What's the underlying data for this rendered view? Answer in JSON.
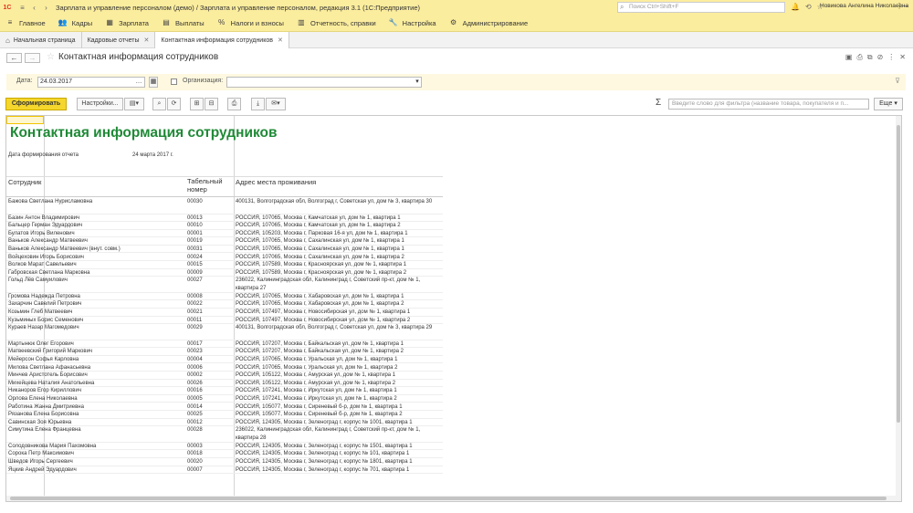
{
  "app": {
    "logo": "1С",
    "title": "Зарплата и управление персоналом (демо) / Зарплата и управление персоналом, редакция 3.1  (1С:Предприятие)",
    "search_placeholder": "Поиск Ctrl+Shift+F",
    "user": "Новикова Ангелина Николаевна"
  },
  "menu": [
    {
      "icon": "hamburger-icon",
      "glyph": "≡",
      "label": "Главное"
    },
    {
      "icon": "people-icon",
      "glyph": "👥",
      "label": "Кадры"
    },
    {
      "icon": "salary-icon",
      "glyph": "▦",
      "label": "Зарплата"
    },
    {
      "icon": "payments-icon",
      "glyph": "▤",
      "label": "Выплаты"
    },
    {
      "icon": "percent-icon",
      "glyph": "%",
      "label": "Налоги и взносы"
    },
    {
      "icon": "reports-icon",
      "glyph": "▥",
      "label": "Отчетность, справки"
    },
    {
      "icon": "wrench-icon",
      "glyph": "🔧",
      "label": "Настройка"
    },
    {
      "icon": "admin-icon",
      "glyph": "⚙",
      "label": "Администрирование"
    }
  ],
  "tabs": [
    {
      "label": "Начальная страница",
      "active": false
    },
    {
      "label": "Кадровые отчеты",
      "active": false
    },
    {
      "label": "Контактная информация сотрудников",
      "active": true
    }
  ],
  "form": {
    "title": "Контактная информация сотрудников"
  },
  "params": {
    "date_label": "Дата:",
    "date_value": "24.03.2017",
    "org_label": "Организация:",
    "org_value": ""
  },
  "toolbar": {
    "generate": "Сформировать",
    "settings": "Настройки...",
    "filter_placeholder": "Введите слово для фильтра (название товара, покупателя и п...",
    "more": "Еще"
  },
  "report": {
    "title": "Контактная информация сотрудников",
    "gen_label": "Дата формирования отчета",
    "gen_value": "24 марта 2017 г.",
    "columns": [
      "Сотрудник",
      "Табельный номер",
      "Адрес места проживания"
    ],
    "rows": [
      [
        "Бажова Светлана Нурисламовна",
        "00030",
        "400131, Волгоградская обл, Волгоград г, Советская ул, дом № 3, квартира 30"
      ],
      [
        "Базин Антон Владимирович",
        "00013",
        "РОССИЯ, 107065, Москва г, Камчатская ул, дом № 1, квартира 1"
      ],
      [
        "Бальцер Герман Эдуардович",
        "00010",
        "РОССИЯ, 107065, Москва г, Камчатская ул, дом № 1, квартира 2"
      ],
      [
        "Булатов Игорь Виленович",
        "00001",
        "РОССИЯ, 105203, Москва г, Парковая 16-я ул, дом № 1, квартира 1"
      ],
      [
        "Ваньков Александр Матвеевич",
        "00019",
        "РОССИЯ, 107065, Москва г, Сахалинская ул, дом № 1, квартира 1"
      ],
      [
        "Ваньков Александр Матвеевич (внут. совм.)",
        "00031",
        "РОССИЯ, 107065, Москва г, Сахалинская ул, дом № 1, квартира 1"
      ],
      [
        "Войцеховин Игорь Борисович",
        "00024",
        "РОССИЯ, 107065, Москва г, Сахалинская ул, дом № 1, квартира 2"
      ],
      [
        "Волков Марат Савельевич",
        "00015",
        "РОССИЯ, 107589, Москва г, Красноярская ул, дом № 1, квартира 1"
      ],
      [
        "Габровская Светлана Марковна",
        "00009",
        "РОССИЯ, 107589, Москва г, Красноярская ул, дом № 1, квартира 2"
      ],
      [
        "Гольд Лёв Самуилович",
        "00027",
        "236022, Калининградская обл, Калининград г, Советский пр-кт, дом № 1, квартира 27"
      ],
      [
        "Громова Надежда Петровна",
        "00008",
        "РОССИЯ, 107065, Москва г, Хабаровская ул, дом № 1, квартира 1"
      ],
      [
        "Захарчин Савелий Петрович",
        "00022",
        "РОССИЯ, 107065, Москва г, Хабаровская ул, дом № 1, квартира 2"
      ],
      [
        "Козьмин Глеб Матвеевич",
        "00021",
        "РОССИЯ, 107497, Москва г, Новосибирская ул, дом № 1, квартира 1"
      ],
      [
        "Кузьминых Борис Семенович",
        "00011",
        "РОССИЯ, 107497, Москва г, Новосибирская ул, дом № 1, квартира 2"
      ],
      [
        "Кураев Назар Магомедович",
        "00029",
        "400131, Волгоградская обл, Волгоград г, Советская ул, дом № 3, квартира 29"
      ],
      [
        "Мартынюк Олег Егорович",
        "00017",
        "РОССИЯ, 107207, Москва г, Байкальская ул, дом № 1, квартира 1"
      ],
      [
        "Матвеевский Григорий Маркович",
        "00023",
        "РОССИЯ, 107207, Москва г, Байкальская ул, дом № 1, квартира 2"
      ],
      [
        "Мейерсон Софья Карловна",
        "00004",
        "РОССИЯ, 107065, Москва г, Уральская ул, дом № 1, квартира 1"
      ],
      [
        "Милова Светлана Афанасьевна",
        "00006",
        "РОССИЯ, 107065, Москва г, Уральская ул, дом № 1, квартира 2"
      ],
      [
        "Минчев Аристотель Борисович",
        "00002",
        "РОССИЯ, 105122, Москва г, Амурская ул, дом № 1, квартира 1"
      ],
      [
        "Михейцева Наталия Анатольевна",
        "00026",
        "РОССИЯ, 105122, Москва г, Амурская ул, дом № 1, квартира 2"
      ],
      [
        "Никаноров Егор Кириллович",
        "00016",
        "РОССИЯ, 107241, Москва г, Иркутская ул, дом № 1, квартира 1"
      ],
      [
        "Орлова Елена Николаевна",
        "00005",
        "РОССИЯ, 107241, Москва г, Иркутская ул, дом № 1, квартира 2"
      ],
      [
        "Работина Жанна Дмитриевна",
        "00014",
        "РОССИЯ, 105077, Москва г, Сиреневый б-р, дом № 1, квартира 1"
      ],
      [
        "Рязанова Елена Борисовна",
        "00025",
        "РОССИЯ, 105077, Москва г, Сиреневый б-р, дом № 1, квартира 2"
      ],
      [
        "Савинская Зоя Юрьевна",
        "00012",
        "РОССИЯ, 124305, Москва г, Зеленоград г, корпус № 1001, квартира 1"
      ],
      [
        "Симутина Елена Францевна",
        "00028",
        "236022, Калининградская обл, Калининград г, Советский пр-кт, дом № 1, квартира 28"
      ],
      [
        "Солодовникова Мария Пахомовна",
        "00003",
        "РОССИЯ, 124305, Москва г, Зеленоград г, корпус № 1501, квартира 1"
      ],
      [
        "Сорока Петр Максимович",
        "00018",
        "РОССИЯ, 124305, Москва г, Зеленоград г, корпус № 101, квартира 1"
      ],
      [
        "Шведов Игорь Сергеевич",
        "00020",
        "РОССИЯ, 124305, Москва г, Зеленоград г, корпус № 1801, квартира 1"
      ],
      [
        "Яцкив Андрей Эдуардович",
        "00007",
        "РОССИЯ, 124305, Москва г, Зеленоград г, корпус № 701, квартира 1"
      ]
    ]
  },
  "colors": {
    "accent": "#fbed9e",
    "report_title": "#1f8a36",
    "primary_button": "#f5d62c"
  }
}
